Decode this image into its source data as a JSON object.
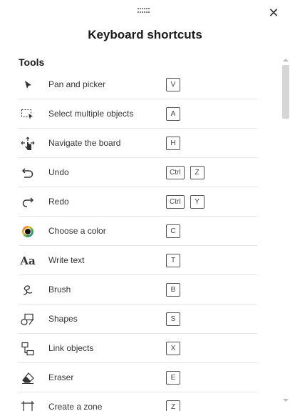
{
  "dialog": {
    "title": "Keyboard shortcuts",
    "close_icon": "close-icon",
    "drag_icon": "drag-handle-icon"
  },
  "section": {
    "title": "Tools"
  },
  "shortcuts": [
    {
      "icon": "pointer-icon",
      "label": "Pan and picker",
      "keys": [
        "V"
      ]
    },
    {
      "icon": "select-multiple-icon",
      "label": "Select multiple objects",
      "keys": [
        "A"
      ]
    },
    {
      "icon": "navigate-hand-icon",
      "label": "Navigate the board",
      "keys": [
        "H"
      ]
    },
    {
      "icon": "undo-icon",
      "label": "Undo",
      "keys": [
        "Ctrl",
        "Z"
      ]
    },
    {
      "icon": "redo-icon",
      "label": "Redo",
      "keys": [
        "Ctrl",
        "Y"
      ]
    },
    {
      "icon": "color-wheel-icon",
      "label": "Choose a color",
      "keys": [
        "C"
      ]
    },
    {
      "icon": "text-icon",
      "label": "Write text",
      "keys": [
        "T"
      ]
    },
    {
      "icon": "brush-icon",
      "label": "Brush",
      "keys": [
        "B"
      ]
    },
    {
      "icon": "shapes-icon",
      "label": "Shapes",
      "keys": [
        "S"
      ]
    },
    {
      "icon": "link-objects-icon",
      "label": "Link objects",
      "keys": [
        "X"
      ]
    },
    {
      "icon": "eraser-icon",
      "label": "Eraser",
      "keys": [
        "E"
      ]
    },
    {
      "icon": "zone-icon",
      "label": "Create a zone",
      "keys": [
        "Z"
      ]
    }
  ],
  "colors": {
    "text": "#333333",
    "title": "#1a1a1a",
    "divider": "#e3e3e3",
    "key_border": "#555555",
    "scroll_thumb": "#d6d6d6"
  }
}
